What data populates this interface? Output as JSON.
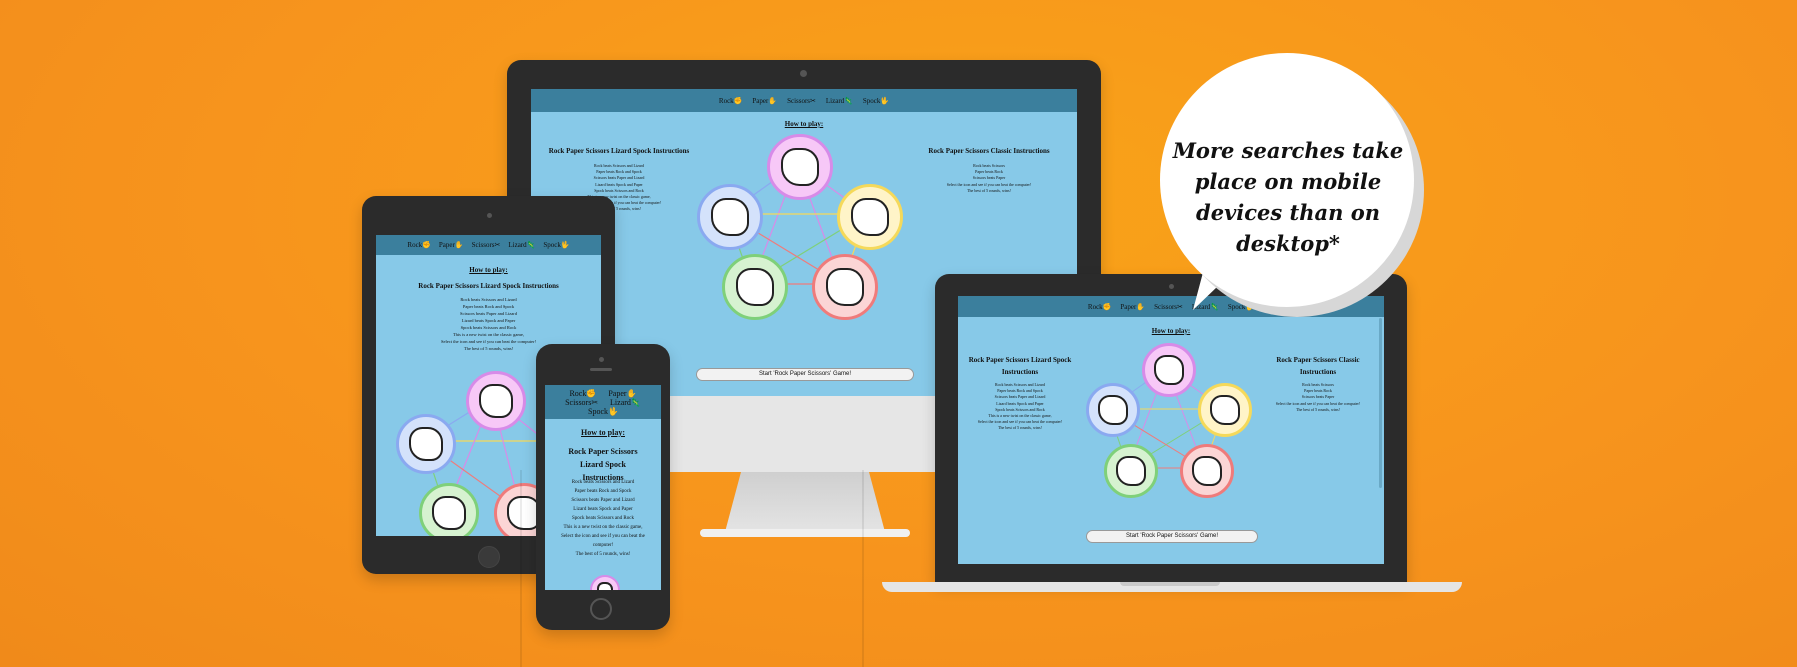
{
  "nav": {
    "rock": "Rock✊",
    "paper": "Paper✋",
    "scissors": "Scissors✂",
    "lizard": "Lizard🦎",
    "spock": "Spock🖖"
  },
  "how_to_play": "How to play:",
  "rpsls": {
    "title": "Rock Paper Scissors Lizard Spock Instructions",
    "rules": [
      "Rock beats Scissors and Lizard",
      "Paper beats Rock and Spock",
      "Scissors beats Paper and Lizard",
      "Lizard beats Spock and Paper",
      "Spock beats Scissors and Rock",
      "This is a new twist on the classic game,",
      "Select the icon and see if you can beat the computer!",
      "The best of 5 rounds, wins!"
    ]
  },
  "classic": {
    "title": "Rock Paper Scissors Classic Instructions",
    "rules": [
      "Rock beats Scissors",
      "Paper beats Rock",
      "Scissors beats Paper",
      "Select the icon and see if you can beat the computer!",
      "The best of 5 rounds, wins!"
    ]
  },
  "start_button": "Start 'Rock Paper Scissors' Game!",
  "callout": "More searches take place on mobile devices than on desktop*",
  "icons": {
    "scissors": "scissors-hand-icon",
    "paper": "paper-hand-icon",
    "rock": "rock-hand-icon",
    "lizard": "lizard-hand-icon",
    "spock": "spock-hand-icon"
  },
  "colors": {
    "background": "#f7941d",
    "screen": "#87c9e8",
    "nav": "#3b7f9d",
    "scissors": "#d78be8",
    "paper": "#f5d95a",
    "rock": "#ef7b7b",
    "lizard": "#7fd07a",
    "spock": "#8aa9f0"
  }
}
